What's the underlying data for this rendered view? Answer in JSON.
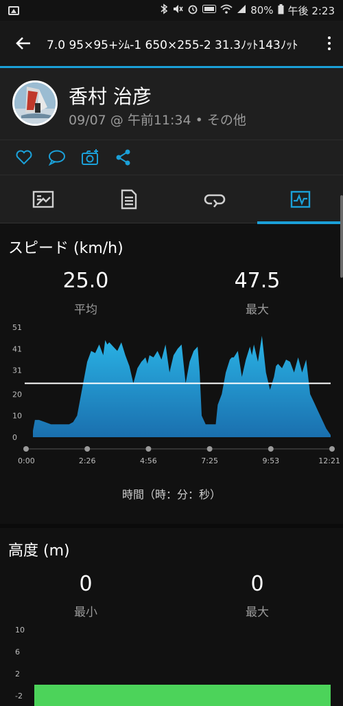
{
  "status_bar": {
    "battery": "80%",
    "time": "午後 2:23",
    "icons": [
      "image-icon",
      "bluetooth-icon",
      "mute-icon",
      "alarm-icon",
      "volte-icon",
      "wifi-icon",
      "signal-icon",
      "battery-icon"
    ]
  },
  "app_bar": {
    "title": "7.0 95×95+ｼﾑ-1 650×255-2 31.3ﾉｯﾄ143ﾉｯﾄ"
  },
  "profile": {
    "name": "香村 治彦",
    "meta": "09/07 @ 午前11:34 • その他"
  },
  "actions": [
    "like-icon",
    "comment-icon",
    "add-photo-icon",
    "share-icon"
  ],
  "tabs": [
    {
      "icon": "summary-icon",
      "active": false
    },
    {
      "icon": "details-icon",
      "active": false
    },
    {
      "icon": "laps-icon",
      "active": false
    },
    {
      "icon": "charts-icon",
      "active": true
    }
  ],
  "speed": {
    "title": "スピード (km/h)",
    "avg_value": "25.0",
    "avg_label": "平均",
    "max_value": "47.5",
    "max_label": "最大",
    "x_axis_title": "時間（時：分：秒）"
  },
  "altitude": {
    "title": "高度 (m)",
    "min_value": "0",
    "min_label": "最小",
    "max_value": "0",
    "max_label": "最大"
  },
  "colors": {
    "accent": "#1ba0d8",
    "speed_fill_top": "#2ab4e6",
    "speed_fill_bottom": "#1a6fae",
    "altitude_fill": "#4cd35a"
  },
  "chart_data": [
    {
      "type": "area",
      "yticks": [
        "51",
        "41",
        "31",
        "20",
        "10",
        "0"
      ],
      "y_tick_values": [
        51,
        41,
        31,
        20,
        10,
        0
      ],
      "ylim": [
        0,
        51
      ],
      "xticks": [
        "0:00",
        "2:26",
        "4:56",
        "7:25",
        "9:53",
        "12:21"
      ],
      "xlim": [
        0,
        741
      ],
      "average": 25.0,
      "x": [
        0,
        5,
        15,
        30,
        45,
        60,
        75,
        90,
        100,
        110,
        125,
        135,
        145,
        155,
        165,
        175,
        180,
        185,
        190,
        200,
        210,
        220,
        230,
        240,
        250,
        260,
        270,
        275,
        280,
        285,
        290,
        300,
        310,
        320,
        330,
        340,
        350,
        360,
        370,
        380,
        390,
        400,
        410,
        415,
        420,
        430,
        440,
        450,
        455,
        460,
        470,
        480,
        490,
        495,
        500,
        510,
        520,
        530,
        540,
        545,
        550,
        560,
        570,
        580,
        590,
        600,
        605,
        610,
        620,
        630,
        640,
        650,
        660,
        670,
        680,
        690,
        700,
        710,
        720,
        730,
        741
      ],
      "values": [
        3,
        8,
        8,
        7,
        6,
        6,
        6,
        6,
        7,
        10,
        25,
        35,
        40,
        39,
        43,
        38,
        45,
        43,
        44,
        42,
        40,
        44,
        38,
        33,
        25,
        32,
        35,
        36,
        37,
        34,
        38,
        37,
        40,
        36,
        43,
        30,
        38,
        41,
        43,
        25,
        35,
        40,
        42,
        30,
        10,
        6,
        6,
        6,
        6,
        15,
        20,
        30,
        36,
        37,
        37,
        40,
        28,
        36,
        42,
        38,
        43,
        35,
        47,
        30,
        22,
        28,
        33,
        34,
        32,
        36,
        35,
        30,
        37,
        30,
        36,
        20,
        16,
        12,
        8,
        4,
        1
      ]
    },
    {
      "type": "area",
      "yticks": [
        "10",
        "6",
        "2",
        "-2"
      ],
      "y_tick_values": [
        10,
        6,
        2,
        -2
      ],
      "ylim": [
        -2,
        10
      ],
      "values": [
        0
      ]
    }
  ]
}
